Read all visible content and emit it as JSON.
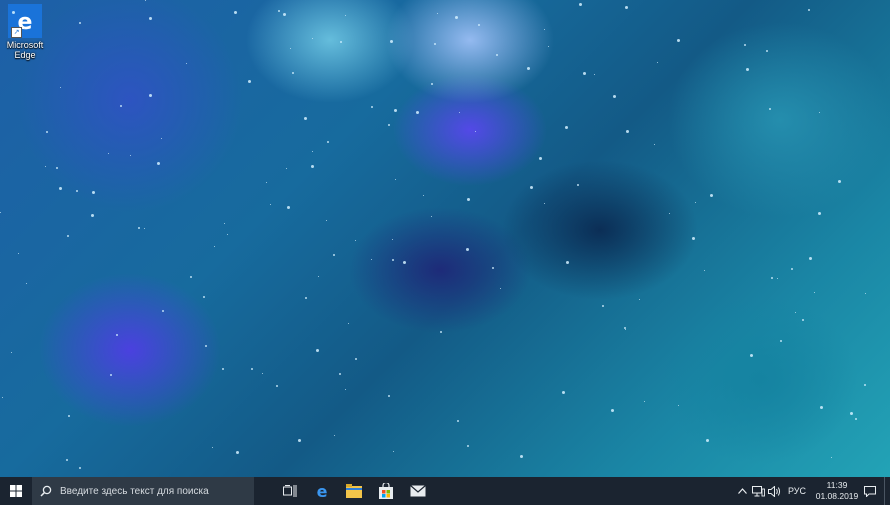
{
  "desktop": {
    "icons": [
      {
        "label": "Microsoft Edge"
      }
    ]
  },
  "taskbar": {
    "search": {
      "placeholder": "Введите здесь текст для поиска"
    },
    "pinned_apps": [
      "task-view",
      "edge",
      "file-explorer",
      "store",
      "mail"
    ],
    "tray": {
      "language": "РУС",
      "time": "11:39",
      "date": "01.08.2019"
    }
  },
  "colors": {
    "taskbar_bg": "#1b2430",
    "search_bg": "#2f3a46",
    "edge_blue": "#1a73d9",
    "explorer_yellow": "#f3c54a"
  }
}
